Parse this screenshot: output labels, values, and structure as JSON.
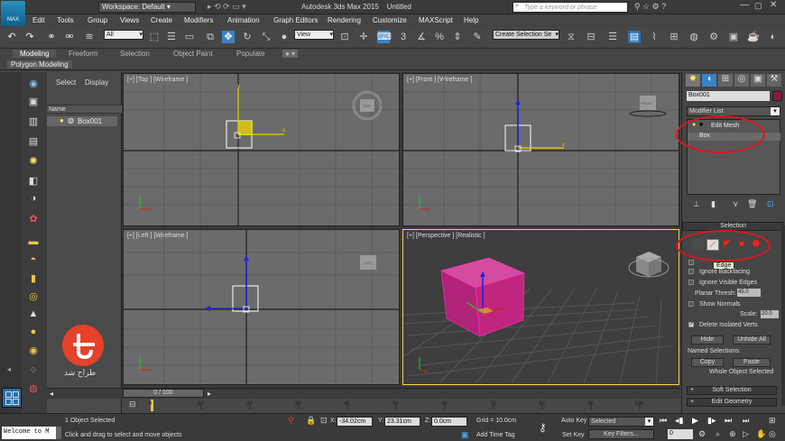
{
  "titlebar": {
    "app_logo": "MAX",
    "workspace": "Workspace: Default",
    "app_title": "Autodesk 3ds Max  2015",
    "doc_name": "Untitled",
    "search_placeholder": "Type a keyword or phrase"
  },
  "menubar": [
    "Edit",
    "Tools",
    "Group",
    "Views",
    "Create",
    "Modifiers",
    "Animation",
    "Graph Editors",
    "Rendering",
    "Customize",
    "MAXScript",
    "Help"
  ],
  "toolbar": {
    "selection_filter": "All",
    "ref_coord": "View",
    "named_selection": "Create Selection Se"
  },
  "ribbon": {
    "tabs": [
      "Modeling",
      "Freeform",
      "Selection",
      "Object Paint",
      "Populate"
    ],
    "sub_label": "Polygon Modeling"
  },
  "scene_explorer": {
    "tabs": [
      "Select",
      "Display"
    ],
    "column_name": "Name",
    "object": "Box001"
  },
  "viewports": {
    "top": "[+] [Top ] [Wireframe ]",
    "front": "[+] [Front ] [Wireframe ]",
    "left": "[+] [Left ] [Wireframe ]",
    "perspective": "[+] [Perspective ] [Realistic ]",
    "viewcube_top": "TOP",
    "viewcube_front": "FRONT",
    "viewcube_left": "LEFT"
  },
  "command_panel": {
    "object_name": "Box001",
    "object_color": "#8b1a3a",
    "modifier_list": "Modifier List",
    "stack": [
      "Edit Mesh",
      "Box"
    ],
    "selection_title": "Selection",
    "tooltip": "Edge",
    "checkboxes": {
      "by_vertex": "By Vertex",
      "ignore_backfacing": "Ignore Backfacing",
      "ignore_visible_edges": "Ignore Visible Edges",
      "planar_thresh_label": "Planar Thresh:",
      "planar_thresh_value": "45.0",
      "show_normals": "Show Normals",
      "scale_label": "Scale:",
      "scale_value": "20.0",
      "delete_isolated": "Delete Isolated Verts"
    },
    "hide": "Hide",
    "unhide_all": "Unhide All",
    "named_selections": "Named Selections:",
    "copy": "Copy",
    "paste": "Paste",
    "whole_object": "Whole Object Selected",
    "soft_selection": "Soft Selection",
    "edit_geometry": "Edit Geometry"
  },
  "timeline": {
    "frame": "0 / 100",
    "ticks": [
      "0",
      "10",
      "20",
      "30",
      "40",
      "50",
      "60",
      "70",
      "80",
      "90",
      "100"
    ]
  },
  "statusbar": {
    "listener": "Welcome to M",
    "selected": "1 Object Selected",
    "prompt": "Click and drag to select and move objects",
    "x_label": "X:",
    "x": "-34.02cm",
    "y_label": "Y:",
    "y": "23.31cm",
    "z_label": "Z:",
    "z": "0.0cm",
    "grid": "Grid = 10.0cm",
    "add_time_tag": "Add Time Tag",
    "auto_key": "Auto Key",
    "set_key": "Set Key",
    "key_mode": "Selected",
    "key_filters": "Key Filters...",
    "frame_num": "0"
  },
  "watermark": {
    "text": "طراح شد"
  },
  "colors": {
    "accent_red": "#e0141e",
    "box_magenta": "#c0267e",
    "selection_yellow": "#ffd24a"
  }
}
